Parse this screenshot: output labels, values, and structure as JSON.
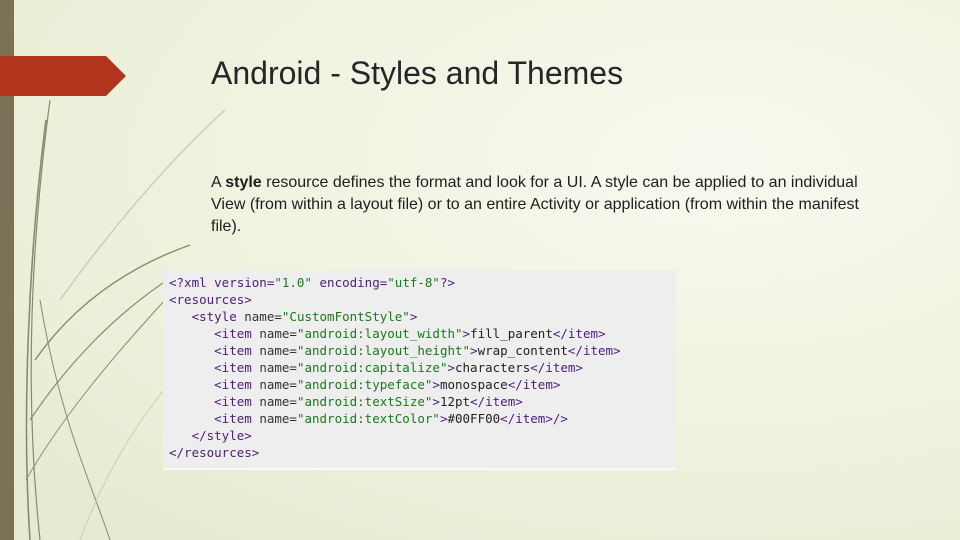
{
  "slide": {
    "title": "Android - Styles and Themes",
    "paragraph": {
      "before": "A ",
      "bold": "style",
      "after": " resource defines the format and look for a UI. A style can be applied to an individual View (from within a layout file) or to an entire Activity or application (from within the manifest file)."
    }
  },
  "code": {
    "line1": {
      "pre": "<?xml version=",
      "v1": "\"1.0\"",
      "mid": " encoding=",
      "v2": "\"utf-8\"",
      "end": "?>"
    },
    "line2": "<resources>",
    "line3": {
      "indent": "   ",
      "tag": "<style",
      "attr": " name=",
      "val": "\"CustomFontStyle\"",
      "end": ">"
    },
    "items": [
      {
        "name": "\"android:layout_width\"",
        "value": "fill_parent"
      },
      {
        "name": "\"android:layout_height\"",
        "value": "wrap_content"
      },
      {
        "name": "\"android:capitalize\"",
        "value": "characters"
      },
      {
        "name": "\"android:typeface\"",
        "value": "monospace"
      },
      {
        "name": "\"android:textSize\"",
        "value": "12pt"
      },
      {
        "name": "\"android:textColor\"",
        "value": "#00FF00"
      }
    ],
    "item_indent": "      ",
    "item_open": "<item",
    "item_attr": " name=",
    "item_gt": ">",
    "item_close": "</item>",
    "last_suffix": "/>",
    "line10": "   </style>",
    "line11": "</resources>"
  },
  "colors": {
    "left_bar": "#7b7155",
    "title_arrow": "#b0351c",
    "tag": "#4b1e7a",
    "value": "#1a7a1a"
  }
}
